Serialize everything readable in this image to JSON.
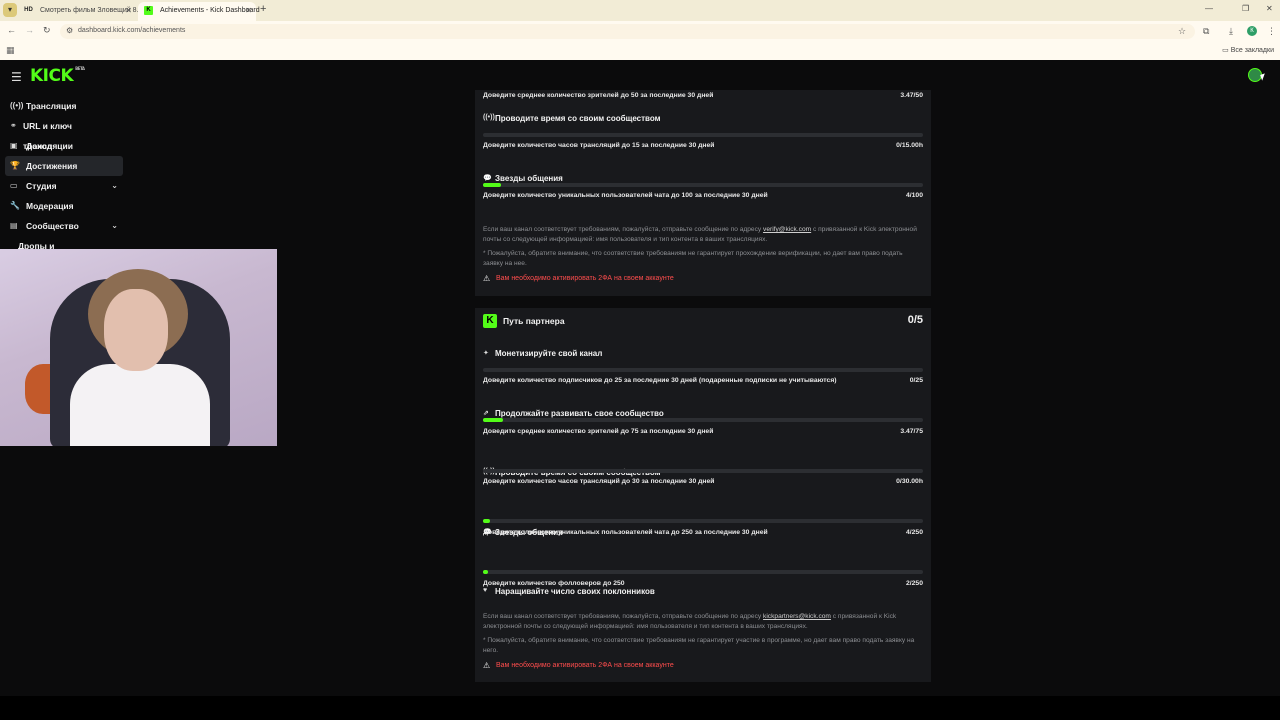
{
  "browser": {
    "tabs": [
      {
        "label": "Смотреть фильм Зловещий 8...",
        "icon": "HD"
      },
      {
        "label": "Achievements - Kick Dashboard",
        "icon": "K"
      }
    ],
    "url": "dashboard.kick.com/achievements",
    "bookmarks_label": "Все закладки",
    "profile_letter": "К"
  },
  "app": {
    "logo": "KICK",
    "logo_tag": "BETA"
  },
  "sidebar": {
    "items": [
      {
        "label": "Трансляция",
        "icon": "broadcast-icon"
      },
      {
        "label": "URL и ключ трансляции",
        "icon": "link-icon"
      },
      {
        "label": "Доход",
        "icon": "money-icon"
      },
      {
        "label": "Достижения",
        "icon": "trophy-icon",
        "active": true
      },
      {
        "label": "Студия",
        "icon": "studio-icon",
        "expandable": true
      },
      {
        "label": "Модерация",
        "icon": "wrench-icon"
      },
      {
        "label": "Сообщество",
        "icon": "community-icon",
        "expandable": true
      },
      {
        "label": "Дропы и вознаграждение"
      }
    ]
  },
  "verified": {
    "goal_viewers": {
      "text": "Доведите среднее количество зрителей до 50 за последние 30 дней",
      "value": "3.47/50"
    },
    "time_title": "Проводите время со своим сообществом",
    "goal_hours": {
      "text": "Доведите количество часов трансляций до 15 за последние 30 дней",
      "value": "0/15.00h",
      "progress": 0
    },
    "chat_title": "Звезды общения",
    "goal_chat": {
      "text": "Доведите количество уникальных пользователей чата до 100 за последние 30 дней",
      "value": "4/100",
      "progress": 0.04
    },
    "note1_a": "Если ваш канал соответствует требованиям, пожалуйста, отправьте сообщение по адресу",
    "note1_email": "verify@kick.com",
    "note1_b": "с привязанной к Kick электронной почты со следующей информацией: имя пользователя и тип контента в ваших трансляциях.",
    "note2": "* Пожалуйста, обратите внимание, что соответствие требованиям не гарантирует прохождение верификации, но дает вам право подать заявку на нее.",
    "warning": "Вам необходимо активировать 2ФА на своем аккаунте"
  },
  "partner": {
    "title": "Путь партнера",
    "count": "0/5",
    "monetize_title": "Монетизируйте свой канал",
    "goal_subs": {
      "text": "Доведите количество подписчиков до 25 за последние 30 дней (подаренные подписки не учитываются)",
      "value": "0/25",
      "progress": 0
    },
    "grow_title": "Продолжайте развивать свое сообщество",
    "goal_viewers": {
      "text": "Доведите среднее количество зрителей до 75 за последние 30 дней",
      "value": "3.47/75",
      "progress": 0.046
    },
    "time_title": "Проводите время со своим сообществом",
    "goal_hours": {
      "text": "Доведите количество часов трансляций до 30 за последние 30 дней",
      "value": "0/30.00h",
      "progress": 0
    },
    "chat_title": "Звезды общения",
    "goal_chat": {
      "text": "Доведите количество уникальных пользователей чата до 250 за последние 30 дней",
      "value": "4/250",
      "progress": 0.016
    },
    "fans_title": "Наращивайте число своих поклонников",
    "goal_followers": {
      "text": "Доведите количество фолловеров до 250",
      "value": "2/250",
      "progress": 0.008
    },
    "note1_a": "Если ваш канал соответствует требованиям, пожалуйста, отправьте сообщение по адресу",
    "note1_email": "kickpartners@kick.com",
    "note1_b": "с привязанной к Kick электронной почты со следующей информацией: имя пользователя и тип контента в ваших трансляциях.",
    "note2": "* Пожалуйста, обратите внимание, что соответствие требованиям не гарантирует участие в программе, но дает вам право подать заявку на него.",
    "warning": "Вам необходимо активировать 2ФА на своем аккаунте"
  },
  "colors": {
    "accent": "#53fc18",
    "warning": "#ff4d4d",
    "panel": "#18191c",
    "background": "#0b0b0c"
  }
}
